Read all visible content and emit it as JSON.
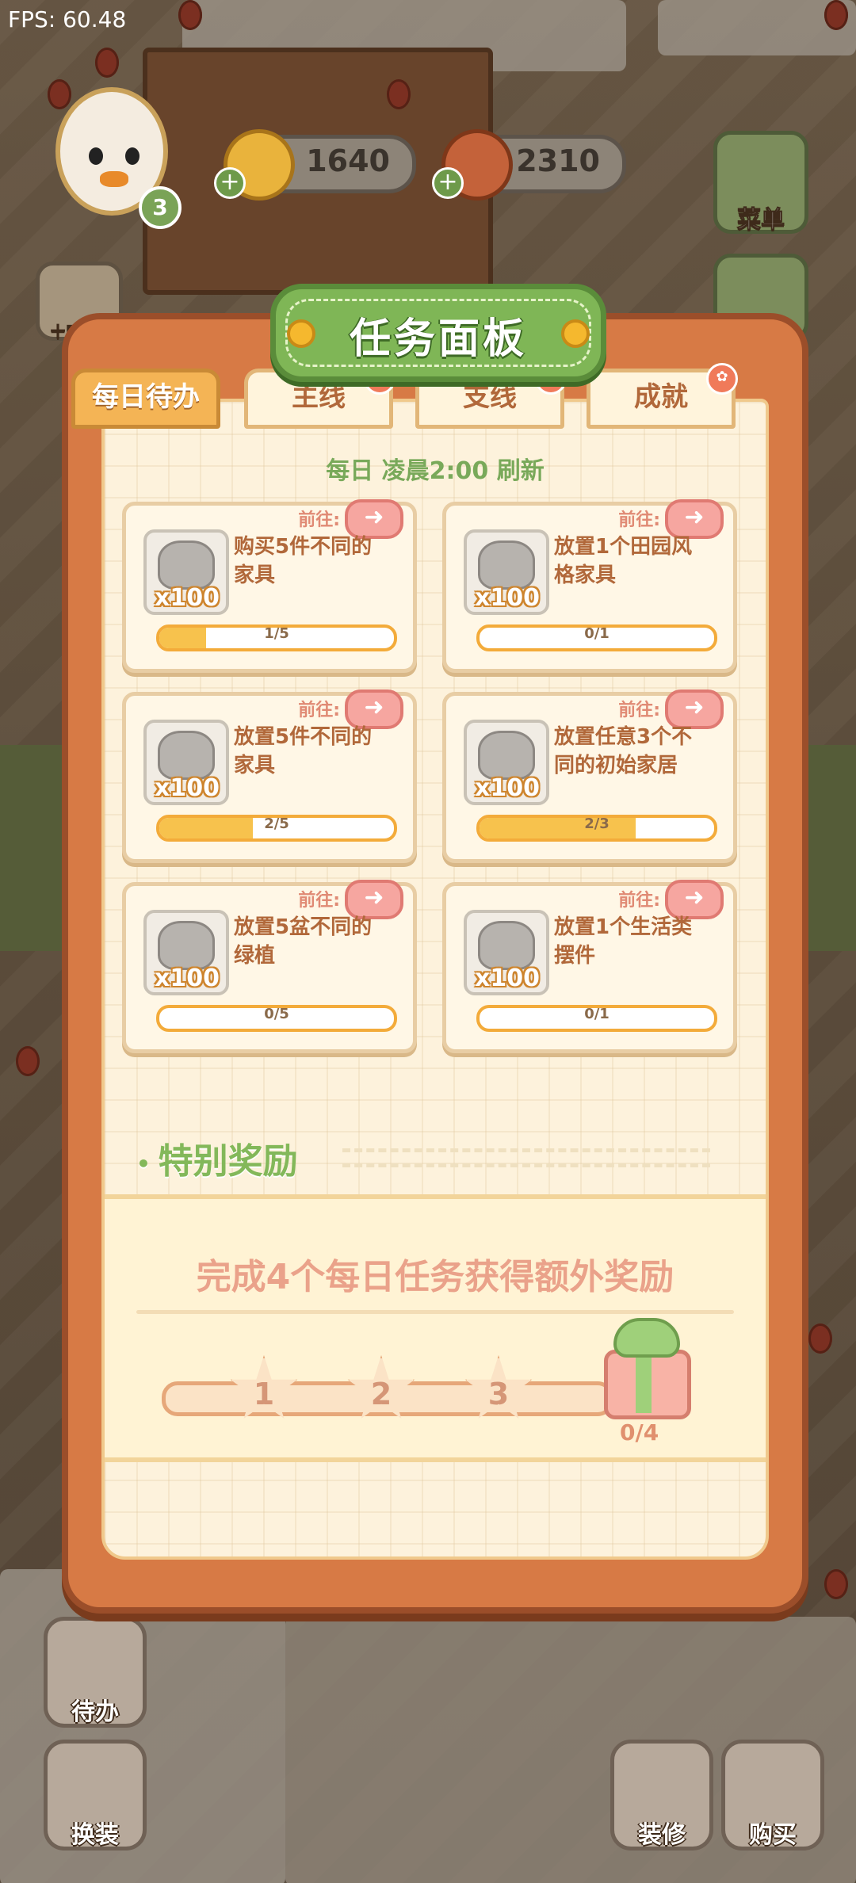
{
  "fps": "FPS: 60.48",
  "player": {
    "level": "3"
  },
  "currency": {
    "coins": "1640",
    "meat": "2310"
  },
  "side_menu": {
    "menu_label": "菜单",
    "signin_label": "十日签到"
  },
  "panel": {
    "title": "任务面板",
    "tabs": [
      {
        "label": "每日待办",
        "active": true
      },
      {
        "label": "主线",
        "active": false
      },
      {
        "label": "支线",
        "active": false
      },
      {
        "label": "成就",
        "active": false
      }
    ],
    "refresh_text": "每日 凌晨2:00 刷新",
    "goto_label": "前往:",
    "tasks": [
      {
        "desc": "购买5件不同的家具",
        "reward": "x100",
        "progress_text": "1/5",
        "progress": 0.2
      },
      {
        "desc": "放置1个田园风格家具",
        "reward": "x100",
        "progress_text": "0/1",
        "progress": 0
      },
      {
        "desc": "放置5件不同的家具",
        "reward": "x100",
        "progress_text": "2/5",
        "progress": 0.4
      },
      {
        "desc": "放置任意3个不同的初始家居",
        "reward": "x100",
        "progress_text": "2/3",
        "progress": 0.667
      },
      {
        "desc": "放置5盆不同的绿植",
        "reward": "x100",
        "progress_text": "0/5",
        "progress": 0
      },
      {
        "desc": "放置1个生活类摆件",
        "reward": "x100",
        "progress_text": "0/1",
        "progress": 0
      }
    ],
    "special": {
      "title": "特别奖励",
      "text": "完成4个每日任务获得额外奖励",
      "milestones": [
        "1",
        "2",
        "3"
      ],
      "count": "0/4"
    }
  },
  "bottom": {
    "todo": "待办",
    "dress": "换装",
    "decorate": "装修",
    "buy": "购买"
  }
}
